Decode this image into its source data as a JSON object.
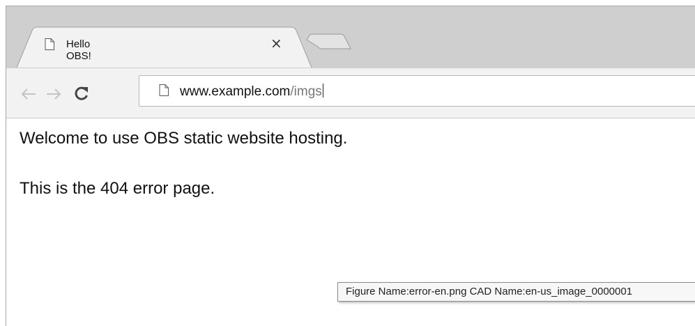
{
  "tab": {
    "title": "Hello OBS!",
    "close_label": "×",
    "icon": "document-icon"
  },
  "toolbar": {
    "back_icon": "back-arrow-icon",
    "forward_icon": "forward-arrow-icon",
    "reload_icon": "reload-icon"
  },
  "address_bar": {
    "host": "www.example.com",
    "path": "/imgs",
    "icon": "document-icon"
  },
  "page": {
    "line1": "Welcome to use OBS static website hosting.",
    "line2": "This is the 404 error page."
  },
  "tooltip": {
    "text": "Figure Name:error-en.png CAD Name:en-us_image_0000001"
  },
  "colors": {
    "tabstrip": "#cfcfcf",
    "toolbar": "#f2f2f2",
    "page": "#ffffff"
  }
}
